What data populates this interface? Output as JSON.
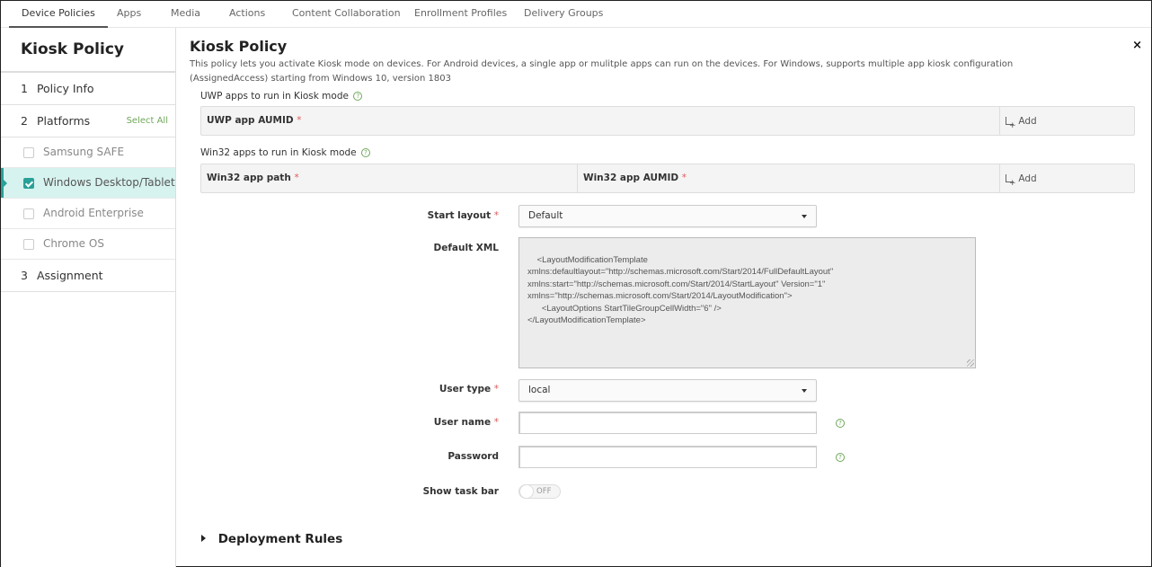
{
  "topnav": {
    "tabs": [
      {
        "label": "Device Policies",
        "active": true
      },
      {
        "label": "Apps"
      },
      {
        "label": "Media"
      },
      {
        "label": "Actions"
      },
      {
        "label": "Content Collaboration"
      },
      {
        "label": "Enrollment Profiles"
      },
      {
        "label": "Delivery Groups"
      }
    ]
  },
  "sidebar": {
    "title": "Kiosk Policy",
    "steps": [
      {
        "num": "1",
        "label": "Policy Info"
      },
      {
        "num": "2",
        "label": "Platforms",
        "action": "Select All"
      },
      {
        "num": "3",
        "label": "Assignment"
      }
    ],
    "platforms": [
      {
        "label": "Samsung SAFE",
        "checked": false
      },
      {
        "label": "Windows Desktop/Tablet",
        "checked": true
      },
      {
        "label": "Android Enterprise",
        "checked": false
      },
      {
        "label": "Chrome OS",
        "checked": false
      }
    ]
  },
  "main": {
    "title": "Kiosk Policy",
    "close": "×",
    "description": "This policy lets you activate Kiosk mode on devices. For Android devices, a single app or mulitple apps can run on the devices. For Windows, supports multiple app kiosk configuration (AssignedAccess) starting from Windows 10, version 1803",
    "uwp": {
      "label": "UWP apps to run in Kiosk mode",
      "col1": "UWP app AUMID",
      "add": "Add"
    },
    "win32": {
      "label": "Win32 apps to run in Kiosk mode",
      "col1": "Win32 app path",
      "col2": "Win32 app AUMID",
      "add": "Add"
    },
    "required_mark": "*",
    "help_glyph": "?",
    "start_layout": {
      "label": "Start layout",
      "value": "Default"
    },
    "default_xml": {
      "label": "Default XML",
      "value": "<LayoutModificationTemplate\nxmlns:defaultlayout=\"http://schemas.microsoft.com/Start/2014/FullDefaultLayout\"\nxmlns:start=\"http://schemas.microsoft.com/Start/2014/StartLayout\" Version=\"1\"\nxmlns=\"http://schemas.microsoft.com/Start/2014/LayoutModification\">\n      <LayoutOptions StartTileGroupCellWidth=\"6\" />\n</LayoutModificationTemplate>"
    },
    "user_type": {
      "label": "User type",
      "value": "local"
    },
    "user_name": {
      "label": "User name",
      "value": ""
    },
    "password": {
      "label": "Password",
      "value": ""
    },
    "show_task_bar": {
      "label": "Show task bar",
      "state": "OFF"
    },
    "deployment_rules": "Deployment Rules"
  },
  "colors": {
    "accent": "#2aa198",
    "help": "#6fa85a",
    "required": "#e05a5a",
    "active_row_bg": "#d7f3ef"
  }
}
